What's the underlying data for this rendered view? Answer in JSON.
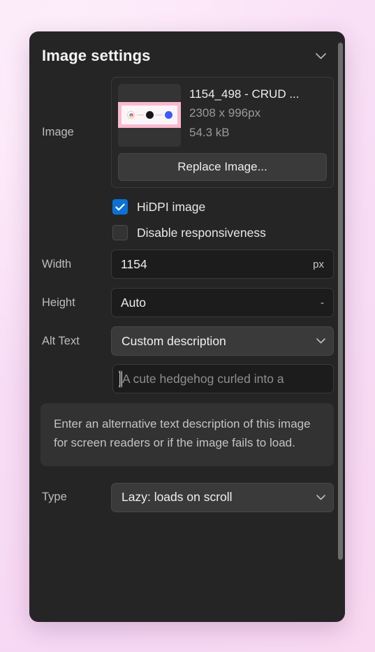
{
  "panel": {
    "title": "Image settings",
    "collapse_icon": "chevron-down-icon"
  },
  "image_row": {
    "label": "Image",
    "name": "1154_498 - CRUD ...",
    "dimensions": "2308 x 996px",
    "filesize": "54.3 kB",
    "replace_label": "Replace Image..."
  },
  "checkboxes": [
    {
      "label": "HiDPI image",
      "checked": true
    },
    {
      "label": "Disable responsiveness",
      "checked": false
    }
  ],
  "width_row": {
    "label": "Width",
    "value": "1154",
    "suffix": "px"
  },
  "height_row": {
    "label": "Height",
    "value": "Auto",
    "suffix": "-"
  },
  "alt_text_row": {
    "label": "Alt Text",
    "mode": "Custom description",
    "placeholder": "A cute hedgehog curled into a"
  },
  "help": {
    "text": "Enter an alternative text description of this image for screen readers or if the image fails to load."
  },
  "type_row": {
    "label": "Type",
    "value": "Lazy: loads on scroll"
  },
  "colors": {
    "panel_bg": "#252525",
    "accent_checkbox": "#0a72d4",
    "background": "#f8dcf5",
    "input_bg": "#1c1c1c",
    "control_bg": "#3a3a3a"
  }
}
